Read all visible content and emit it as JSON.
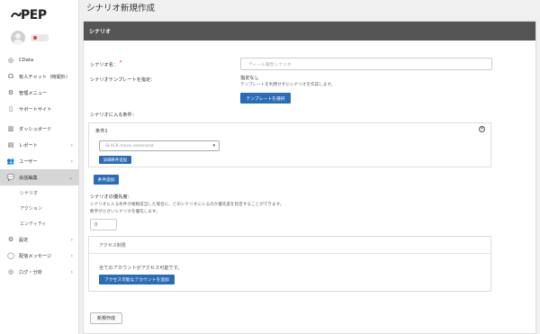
{
  "brand": {
    "logo_text": "PEP"
  },
  "sidebar": {
    "items": [
      {
        "label": "CData",
        "icon": "globe-icon"
      },
      {
        "label": "有人チャット（時間外）",
        "icon": "headset-icon"
      },
      {
        "label": "管理メニュー",
        "icon": "gear-icon"
      },
      {
        "label": "サポートサイト",
        "icon": "tablet-icon"
      },
      {
        "label": "ダッシュボード",
        "icon": "bar-chart-icon"
      },
      {
        "label": "レポート",
        "icon": "report-icon"
      },
      {
        "label": "ユーザー",
        "icon": "users-icon"
      },
      {
        "label": "会話編集",
        "icon": "chat-bubbles-icon"
      },
      {
        "label": "設定",
        "icon": "gears-icon"
      },
      {
        "label": "配信メッセージ",
        "icon": "speech-icon"
      },
      {
        "label": "ログ・分析",
        "icon": "globe-icon"
      }
    ],
    "sub_items": [
      "シナリオ",
      "アクション",
      "エンティティ"
    ]
  },
  "page": {
    "title": "シナリオ新規作成"
  },
  "panel": {
    "header": "シナリオ",
    "name_label": "シナリオ名：",
    "name_required": "*",
    "name_placeholder": "ディール報告シナリオ",
    "template_label": "シナリオテンプレートを指定：",
    "template_value": "指定なし",
    "template_desc": "テンプレートを利用せずにシナリオを作成します。",
    "template_button": "テンプレートを選択",
    "conditions_label": "シナリオに入る条件：",
    "condition": {
      "title": "条件1",
      "select_value": "SLACK move command",
      "detail_button": "詳細条件追加"
    },
    "add_condition_button": "条件追加",
    "priority": {
      "label": "シナリオの優先度：",
      "help_line1": "シナリオに入る条件が複数該当した場合に、どのシナリオに入るのか優先度を指定することができます。",
      "help_line2": "数字が小さいシナリオを優先します。",
      "value": "0"
    },
    "access": {
      "title": "アクセス制限",
      "desc": "全てのアカウントがアクセス可能です。",
      "button": "アクセス可能なアカウントを追加"
    },
    "create_button": "新規作成"
  }
}
